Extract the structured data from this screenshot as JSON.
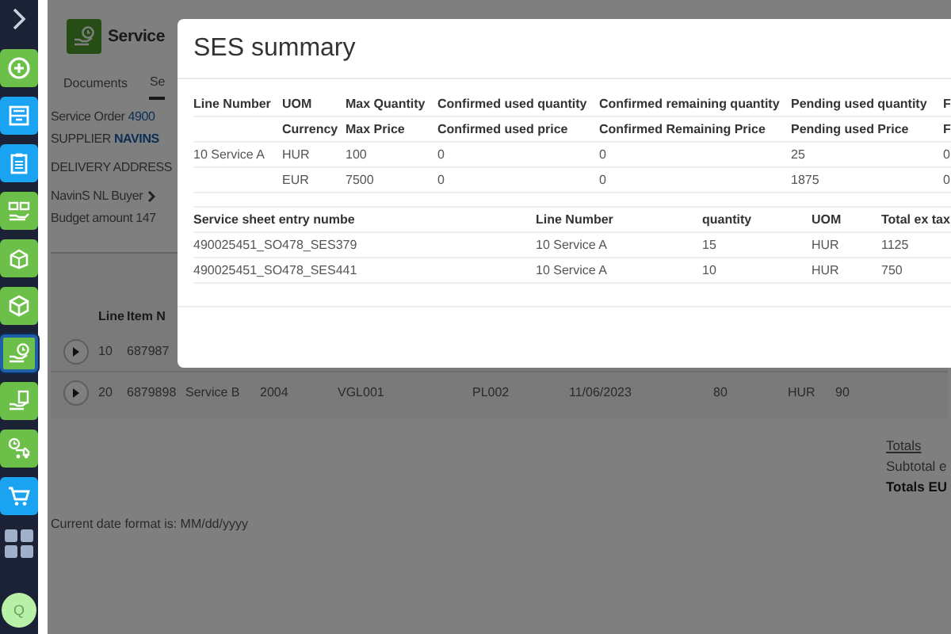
{
  "sidebar": {
    "items": [
      {
        "kind": "plus",
        "color": "#6cc04a",
        "selected": false
      },
      {
        "kind": "drawer",
        "color": "#1aa3f0",
        "selected": false
      },
      {
        "kind": "clipboard",
        "color": "#1aa3f0",
        "selected": false
      },
      {
        "kind": "hand-boxes",
        "color": "#6cc04a",
        "selected": false
      },
      {
        "kind": "package",
        "color": "#6cc04a",
        "selected": false
      },
      {
        "kind": "cube",
        "color": "#6cc04a",
        "selected": false
      },
      {
        "kind": "hand-clock",
        "color": "#6cc04a",
        "selected": true
      },
      {
        "kind": "hand-document",
        "color": "#6cc04a",
        "selected": false
      },
      {
        "kind": "truck-clock",
        "color": "#6cc04a",
        "selected": false
      },
      {
        "kind": "cart",
        "color": "#1aa3f0",
        "selected": false
      },
      {
        "kind": "grid",
        "color": "#9fb0c8",
        "selected": false
      }
    ],
    "avatar": "Q"
  },
  "page": {
    "title": "Service",
    "tabs": [
      {
        "label": "Documents",
        "selected": false
      },
      {
        "label": "Se",
        "selected": true
      }
    ],
    "service_order": {
      "label": "Service Order",
      "value": "4900"
    },
    "supplier": {
      "label": "SUPPLIER",
      "value": "NAVINS"
    },
    "delivery_address_label": "DELIVERY ADDRESS",
    "buyer": "NavinS NL Buyer",
    "budget": {
      "label": "Budget amount",
      "value": "147"
    },
    "lines": {
      "columns": [
        "Line",
        "Item N"
      ],
      "rows": [
        {
          "cells": [
            "10",
            "687987"
          ]
        },
        {
          "cells": [
            "20",
            "6879898",
            "Service B",
            "2004",
            "VGL001",
            "PL002",
            "11/06/2023",
            "80",
            "HUR",
            "90"
          ]
        }
      ]
    },
    "totals": {
      "link": "Totals",
      "subtotal": "Subtotal e",
      "total": "Totals EU"
    },
    "date_note": "Current date format is: MM/dd/yyyy"
  },
  "modal": {
    "title": "SES summary",
    "summary_table": {
      "columns": [
        {
          "title": "Line Number"
        },
        {
          "title": "UOM",
          "subtitle": "Currency"
        },
        {
          "title": "Max Quantity",
          "subtitle": "Max Price"
        },
        {
          "title": "Confirmed used quantity",
          "subtitle": "Confirmed used price"
        },
        {
          "title": "Confirmed remaining quantity",
          "subtitle": "Confirmed Remaining Price"
        },
        {
          "title": "Pending used quantity",
          "subtitle": "Pending used Price"
        },
        {
          "title": "F",
          "subtitle": "F"
        }
      ],
      "rows": [
        {
          "cells": [
            "10 Service A",
            "HUR",
            "100",
            "0",
            "0",
            "25",
            "0"
          ]
        },
        {
          "cells": [
            null,
            "EUR",
            "7500",
            "0",
            "0",
            "1875",
            "0"
          ]
        }
      ]
    },
    "entries_table": {
      "columns": [
        "Service sheet entry numbe",
        "Line Number",
        "quantity",
        "UOM",
        "Total ex tax"
      ],
      "rows": [
        {
          "cells": [
            "490025451_SO478_SES379",
            "10 Service A",
            "15",
            "HUR",
            "1125"
          ]
        },
        {
          "cells": [
            "490025451_SO478_SES441",
            "10 Service A",
            "10",
            "HUR",
            "750"
          ]
        }
      ]
    }
  }
}
